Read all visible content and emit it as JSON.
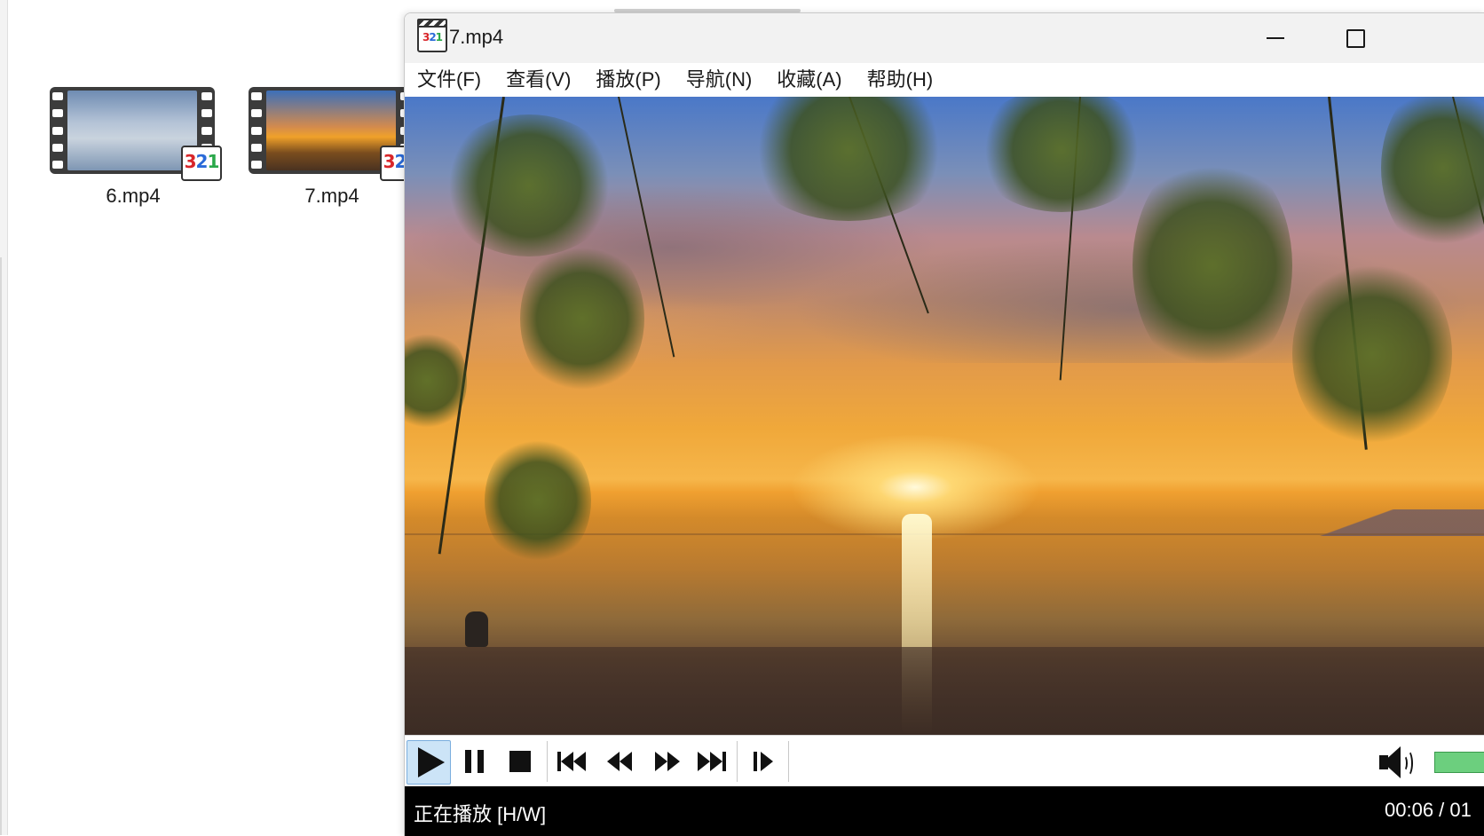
{
  "desktop": {
    "files": [
      {
        "name": "6.mp4",
        "thumb": "seagulls-over-water",
        "badge": "321"
      },
      {
        "name": "7.mp4",
        "thumb": "sunset-over-sea",
        "badge": "321"
      }
    ]
  },
  "player": {
    "app_icon": "mpc-hc-321-icon",
    "badge_text": "321",
    "title": "7.mp4",
    "window_buttons": [
      "minimize-icon",
      "maximize-icon"
    ],
    "menu": [
      {
        "label": "文件(F)"
      },
      {
        "label": "查看(V)"
      },
      {
        "label": "播放(P)"
      },
      {
        "label": "导航(N)"
      },
      {
        "label": "收藏(A)"
      },
      {
        "label": "帮助(H)"
      }
    ],
    "video": {
      "description_icon": "video-frame-sunset-beach"
    },
    "controls": {
      "buttons": [
        "play-icon",
        "pause-icon",
        "stop-icon",
        "skip-previous-icon",
        "rewind-icon",
        "fast-forward-icon",
        "skip-next-icon",
        "frame-step-icon"
      ],
      "active": "play-icon",
      "volume_icon": "speaker-icon",
      "volume_color": "#6ccf7e"
    },
    "status": {
      "text": "正在播放 [H/W]",
      "time": "00:06 / 01"
    }
  },
  "colors": {
    "status_bg": "#000000",
    "active_button": "#cce4f7",
    "titlebar_bg": "#f2f2f2"
  }
}
